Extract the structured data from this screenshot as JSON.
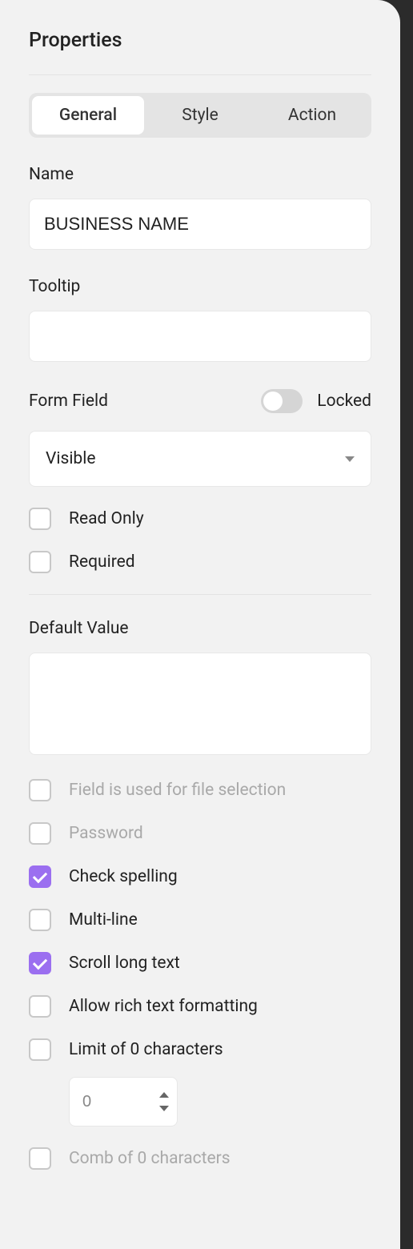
{
  "panel": {
    "title": "Properties"
  },
  "tabs": {
    "general": "General",
    "style": "Style",
    "action": "Action"
  },
  "labels": {
    "name": "Name",
    "tooltip": "Tooltip",
    "formfield": "Form Field",
    "locked": "Locked",
    "defaultvalue": "Default Value"
  },
  "values": {
    "name": "BUSINESS NAME",
    "tooltip": "",
    "visibility": "Visible",
    "defaultvalue": "",
    "limitcount": "0"
  },
  "checks": {
    "readonly": "Read Only",
    "required": "Required",
    "fileselection": "Field is used for file selection",
    "password": "Password",
    "checkspelling": "Check spelling",
    "multiline": "Multi-line",
    "scrolllong": "Scroll long text",
    "richtext": "Allow rich text formatting",
    "limit": "Limit of 0 characters",
    "comb": "Comb of 0 characters"
  }
}
